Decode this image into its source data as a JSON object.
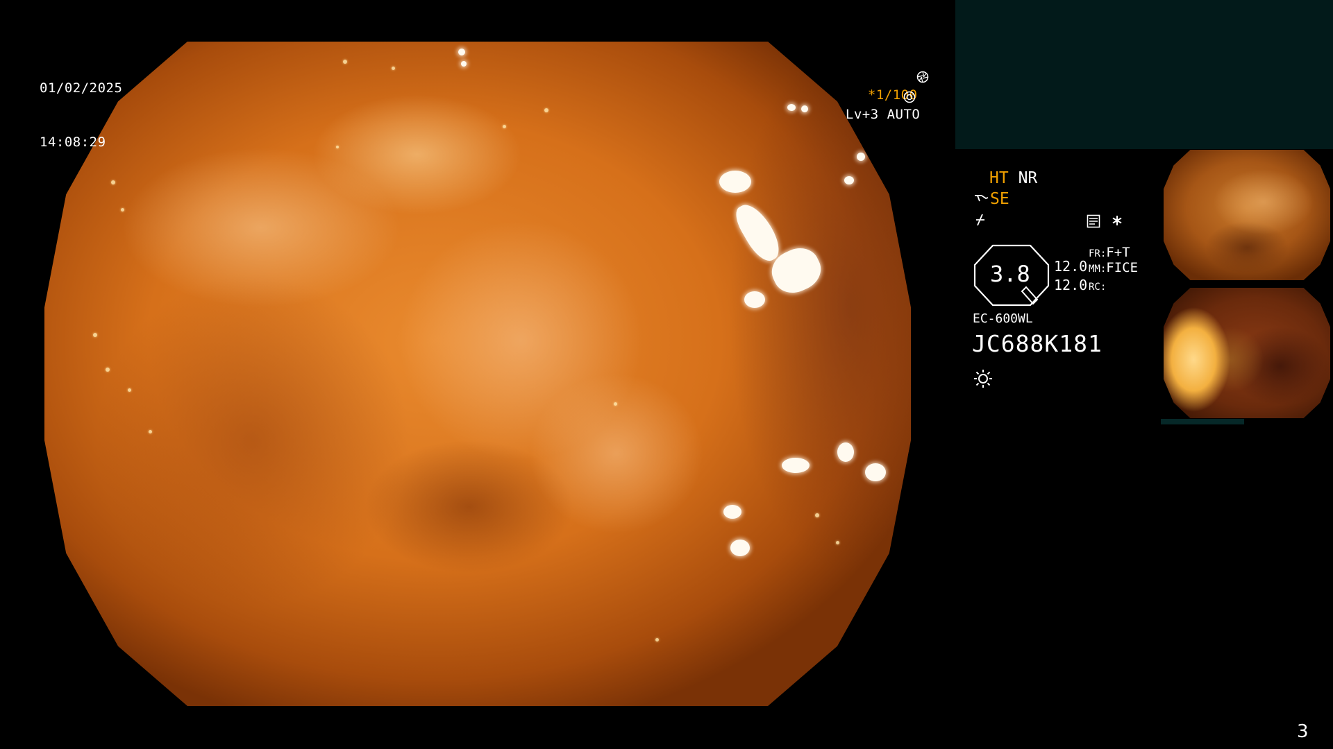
{
  "overlay": {
    "date": "01/02/2025",
    "time": "14:08:29",
    "shutter": "*1/100",
    "level": "Lv+3",
    "mode": "AUTO",
    "page_number": "3"
  },
  "settings": {
    "ht": "HT",
    "nr": "NR",
    "se": "SE",
    "zoom_value": "3.8",
    "val_top": "12.0",
    "val_bottom": "12.0",
    "fr_label": "FR:",
    "fr_value": "F+T",
    "mm_label": "MM:",
    "mm_value": "FICE",
    "rc_label": "RC:",
    "scope_model": "EC-600WL",
    "serial": "JC688K181"
  },
  "icons": {
    "shutter": "aperture-icon",
    "auto": "iris-icon",
    "se": "edge-enhance-icon",
    "fn": "function-icon",
    "memo": "memo-icon",
    "asterisk": "asterisk-icon",
    "light": "light-sun-icon"
  },
  "colors": {
    "accent": "#f0a000",
    "panel": "#021a1a",
    "text": "#ffffff"
  }
}
